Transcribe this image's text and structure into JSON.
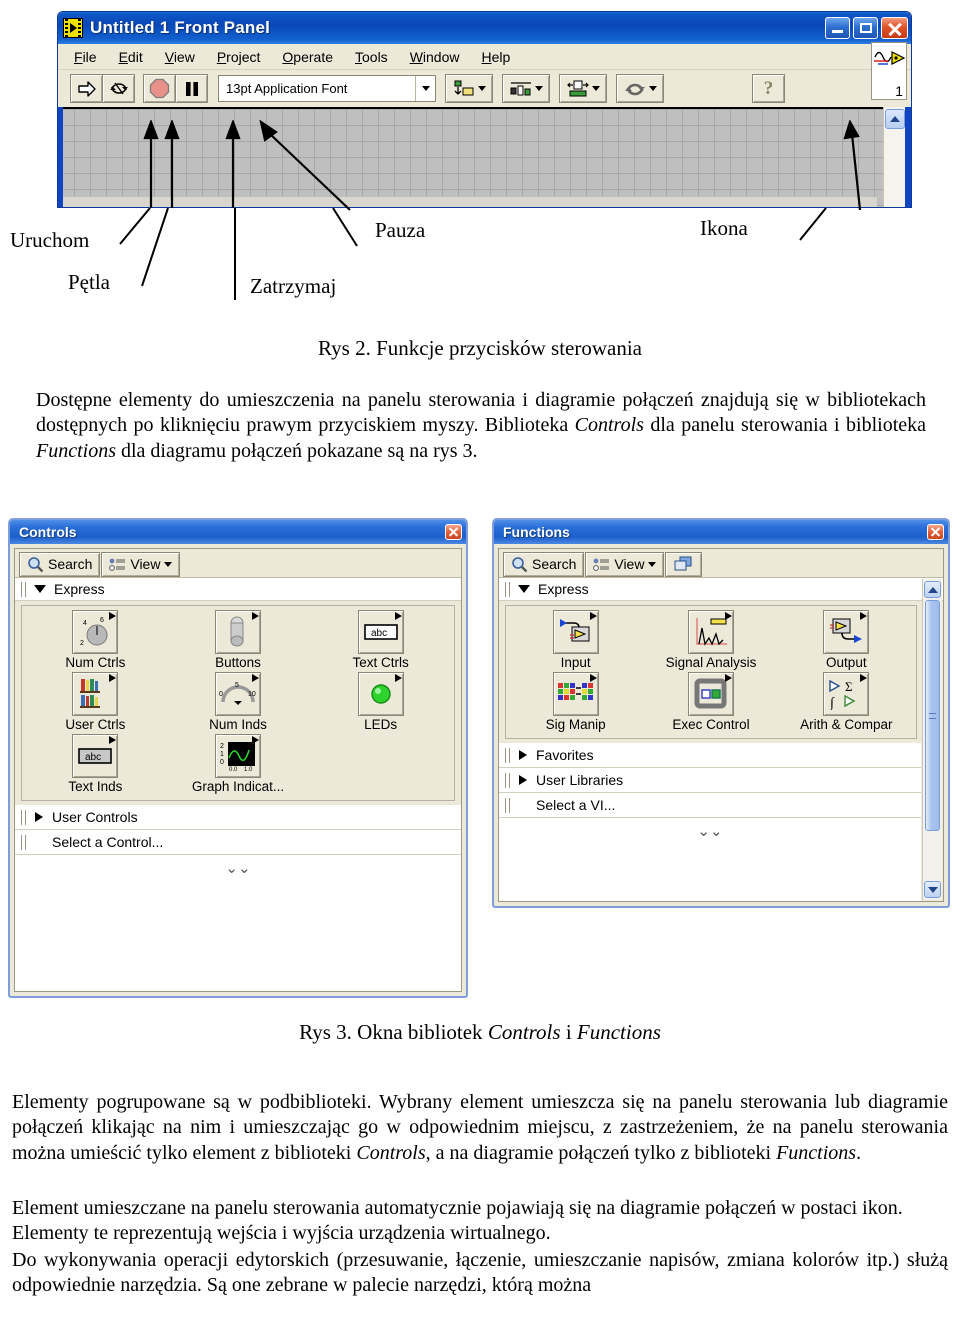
{
  "lv_window": {
    "title": "Untitled 1 Front Panel",
    "menus": [
      {
        "pre": "",
        "acc": "F",
        "post": "ile"
      },
      {
        "pre": "",
        "acc": "E",
        "post": "dit"
      },
      {
        "pre": "",
        "acc": "V",
        "post": "iew"
      },
      {
        "pre": "",
        "acc": "P",
        "post": "roject"
      },
      {
        "pre": "",
        "acc": "O",
        "post": "perate"
      },
      {
        "pre": "",
        "acc": "T",
        "post": "ools"
      },
      {
        "pre": "",
        "acc": "W",
        "post": "indow"
      },
      {
        "pre": "",
        "acc": "H",
        "post": "elp"
      }
    ],
    "toolbar": {
      "run_title": "Run",
      "run_continuous_title": "Run Continuously",
      "abort_title": "Abort Execution",
      "pause_title": "Pause",
      "font_value": "13pt Application Font",
      "align_title": "Align Objects",
      "distribute_title": "Distribute Objects",
      "resize_title": "Resize Objects",
      "reorder_title": "Reorder",
      "help_label": "?",
      "icon_number": "1"
    },
    "window_buttons": {
      "minimize": "Minimize",
      "maximize": "Maximize",
      "close": "Close"
    }
  },
  "fig2": {
    "labels": [
      {
        "text": "Uruchom"
      },
      {
        "text": "Pętla"
      },
      {
        "text": "Zatrzymaj"
      },
      {
        "text": "Pauza"
      },
      {
        "text": "Ikona"
      }
    ],
    "caption": "Rys 2. Funkcje przycisków sterowania"
  },
  "paragraph1": {
    "t1": "Dostępne elementy do umieszczenia na panelu sterowania i diagramie połączeń znajdują się w bibliotekach dostępnych po kliknięciu prawym przyciskiem myszy. Biblioteka ",
    "i1": "Controls",
    "t2": " dla panelu sterowania i biblioteka ",
    "i2": "Functions",
    "t3": " dla diagramu połączeń pokazane są na rys 3."
  },
  "controls_palette": {
    "title": "Controls",
    "search_label": "Search",
    "view_label": "View",
    "express_label": "Express",
    "items": [
      {
        "label": "Num Ctrls",
        "icon": "knob-icon"
      },
      {
        "label": "Buttons",
        "icon": "push-button-icon"
      },
      {
        "label": "Text Ctrls",
        "icon": "text-box-icon"
      },
      {
        "label": "User Ctrls",
        "icon": "bookshelf-icon"
      },
      {
        "label": "Num Inds",
        "icon": "gauge-icon"
      },
      {
        "label": "LEDs",
        "icon": "led-icon"
      },
      {
        "label": "Text Inds",
        "icon": "text-indicator-icon"
      },
      {
        "label": "Graph Indicat...",
        "icon": "graph-icon"
      }
    ],
    "rows": [
      {
        "label": "User Controls",
        "expandable": true
      },
      {
        "label": "Select a Control...",
        "expandable": false
      }
    ],
    "more_glyph": "⌄⌄"
  },
  "functions_palette": {
    "title": "Functions",
    "search_label": "Search",
    "view_label": "View",
    "pin_label": "",
    "express_label": "Express",
    "items": [
      {
        "label": "Input",
        "icon": "input-express-icon"
      },
      {
        "label": "Signal Analysis",
        "icon": "signal-analysis-icon"
      },
      {
        "label": "Output",
        "icon": "output-express-icon"
      },
      {
        "label": "Sig Manip",
        "icon": "signal-manipulation-icon"
      },
      {
        "label": "Exec Control",
        "icon": "execution-control-icon"
      },
      {
        "label": "Arith & Compar",
        "icon": "arithmetic-compare-icon"
      }
    ],
    "rows": [
      {
        "label": "Favorites",
        "expandable": true
      },
      {
        "label": "User Libraries",
        "expandable": true
      },
      {
        "label": "Select a VI...",
        "expandable": false
      }
    ],
    "more_glyph": "⌄⌄"
  },
  "fig3": {
    "caption_pre": "Rys 3. Okna bibliotek ",
    "caption_i1": "Controls",
    "caption_mid": " i ",
    "caption_i2": "Functions"
  },
  "paragraph2": {
    "t1": "Elementy pogrupowane są w podbiblioteki. Wybrany element umieszcza się na panelu sterowania lub diagramie połączeń klikając na nim i umieszczając go w odpowiednim miejscu, z zastrzeżeniem, że na panelu sterowania można umieścić tylko element z  biblioteki ",
    "i1": "Controls",
    "t2": ", a na diagramie połączeń tylko z biblioteki ",
    "i2": "Functions",
    "t3": "."
  },
  "paragraph3": {
    "t1": "Element umieszczane na panelu sterowania automatycznie pojawiają się na diagramie połączeń w postaci ikon. Elementy te reprezentują wejścia i wyjścia urządzenia wirtualnego."
  },
  "paragraph4": {
    "t1": "Do wykonywania operacji edytorskich (przesuwanie, łączenie, umieszczanie napisów, zmiana kolorów itp.) służą odpowiednie narzędzia. Są one zebrane w palecie narzędzi, którą można"
  },
  "colors": {
    "title_blue": "#1d5fcc",
    "window_face": "#ece9d8",
    "canvas_grey": "#bfbfbf",
    "abort_red": "#e08a84",
    "led_green": "#2ed32e"
  }
}
